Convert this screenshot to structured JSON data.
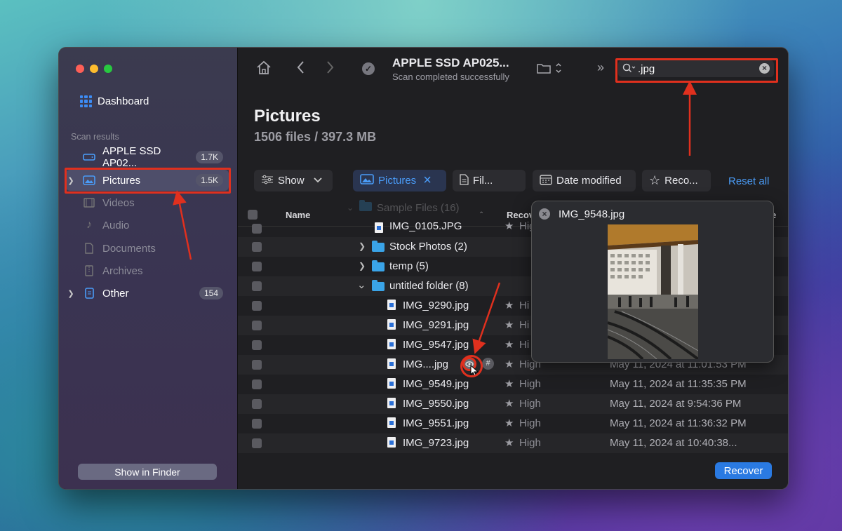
{
  "sidebar": {
    "dashboard_label": "Dashboard",
    "section_label": "Scan results",
    "items": [
      {
        "label": "APPLE SSD AP02...",
        "badge": "1.7K"
      },
      {
        "label": "Pictures",
        "badge": "1.5K"
      },
      {
        "label": "Videos"
      },
      {
        "label": "Audio"
      },
      {
        "label": "Documents"
      },
      {
        "label": "Archives"
      },
      {
        "label": "Other",
        "badge": "154"
      }
    ],
    "show_in_finder": "Show in Finder"
  },
  "toolbar": {
    "device_title": "APPLE SSD AP025...",
    "device_status": "Scan completed successfully",
    "search_value": ".jpg"
  },
  "header": {
    "title": "Pictures",
    "subtitle": "1506 files / 397.3 MB"
  },
  "filters": {
    "show": "Show",
    "pictures": "Pictures",
    "file": "Fil...",
    "date_modified": "Date modified",
    "recovery": "Reco...",
    "reset_all": "Reset all"
  },
  "table": {
    "col_name": "Name",
    "col_recovery": "Recov",
    "col_date_tail": "e",
    "rows": [
      {
        "name": "Sample Files (16)",
        "kind": "folder"
      },
      {
        "name": "IMG_0105.JPG",
        "kind": "file",
        "chance": "High"
      },
      {
        "name": "Stock Photos (2)",
        "kind": "folder"
      },
      {
        "name": "temp (5)",
        "kind": "folder"
      },
      {
        "name": "untitled folder (8)",
        "kind": "folder"
      },
      {
        "name": "IMG_9290.jpg",
        "kind": "file",
        "chance": "Hi"
      },
      {
        "name": "IMG_9291.jpg",
        "kind": "file",
        "chance": "Hi"
      },
      {
        "name": "IMG_9547.jpg",
        "kind": "file",
        "chance": "Hi"
      },
      {
        "name": "IMG....jpg",
        "kind": "file",
        "chance": "High",
        "date": "May 11, 2024 at 11:01:53 PM"
      },
      {
        "name": "IMG_9549.jpg",
        "kind": "file",
        "chance": "High",
        "date": "May 11, 2024 at 11:35:35 PM"
      },
      {
        "name": "IMG_9550.jpg",
        "kind": "file",
        "chance": "High",
        "date": "May 11, 2024 at 9:54:36 PM"
      },
      {
        "name": "IMG_9551.jpg",
        "kind": "file",
        "chance": "High",
        "date": "May 11, 2024 at 11:36:32 PM"
      },
      {
        "name": "IMG_9723.jpg",
        "kind": "file",
        "chance": "High",
        "date": "May 11, 2024 at 10:40:38..."
      }
    ]
  },
  "preview": {
    "title": "IMG_9548.jpg"
  },
  "recover_label": "Recover",
  "colors": {
    "accent": "#2a7ae2",
    "annotation": "#e0301e",
    "folder": "#3aa4e8"
  }
}
